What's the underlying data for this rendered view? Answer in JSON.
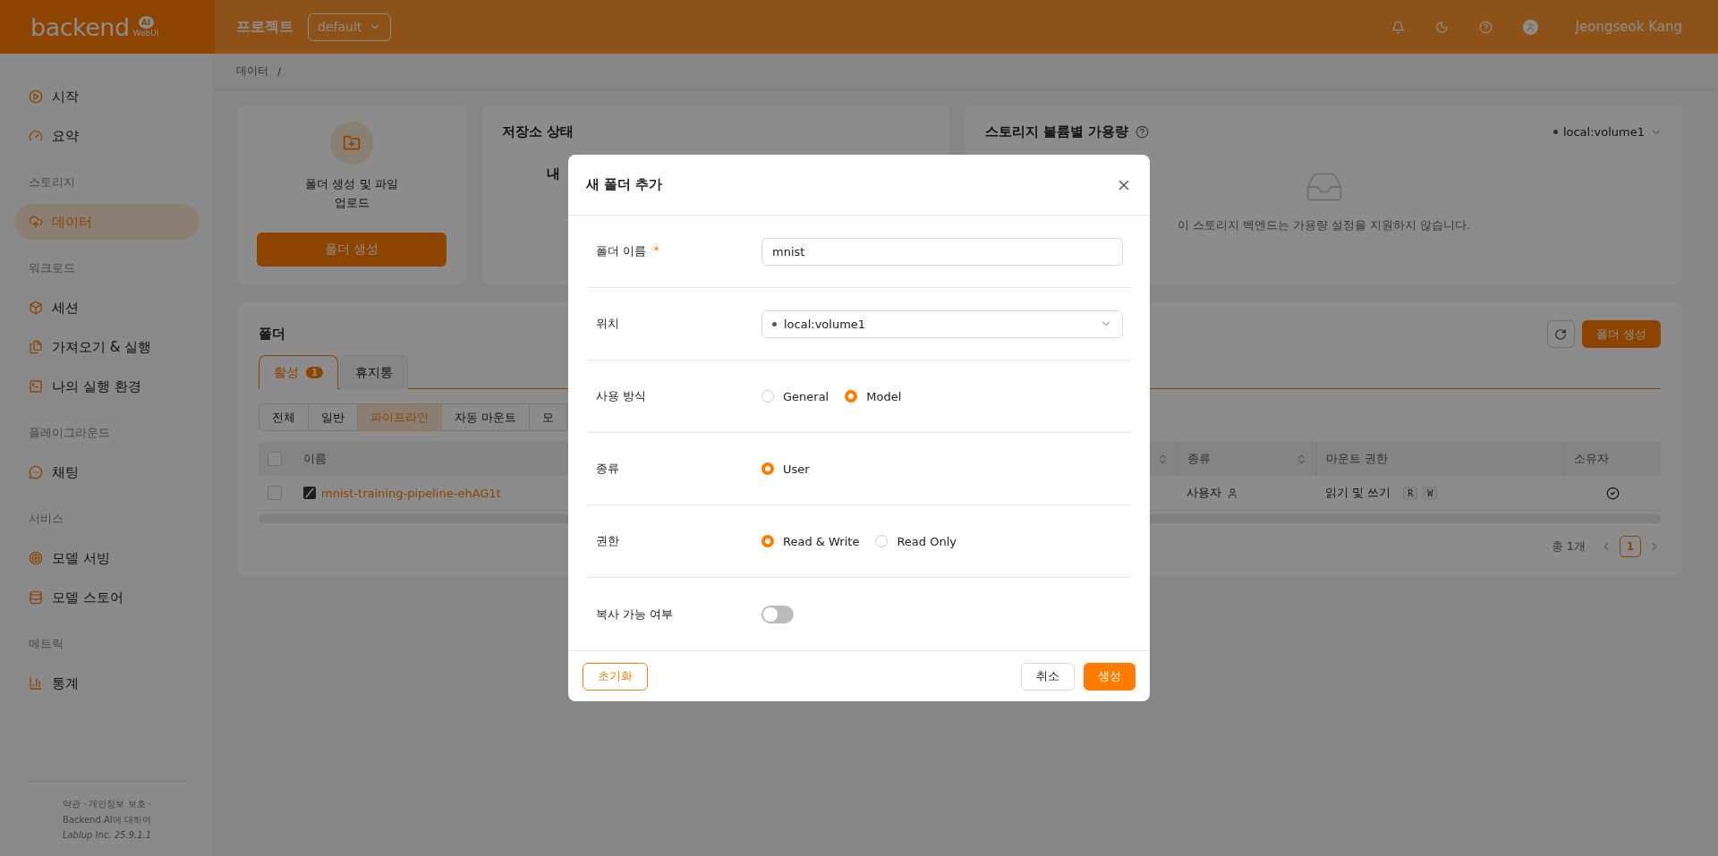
{
  "header": {
    "logo": {
      "word": "backend",
      "badge": "AI",
      "sub": "WebUI"
    },
    "project_label": "프로젝트",
    "project_select": "default",
    "user": "Jeongseok Kang"
  },
  "sidebar": {
    "groups": [
      {
        "items": [
          {
            "label": "시작",
            "selected": false
          },
          {
            "label": "요약",
            "selected": false
          }
        ]
      },
      {
        "heading": "스토리지",
        "items": [
          {
            "label": "데이터",
            "selected": true
          }
        ]
      },
      {
        "heading": "워크로드",
        "items": [
          {
            "label": "세션",
            "selected": false
          },
          {
            "label": "가져오기 & 실행",
            "selected": false
          },
          {
            "label": "나의 실행 환경",
            "selected": false
          }
        ]
      },
      {
        "heading": "플레이그라운드",
        "items": [
          {
            "label": "채팅",
            "selected": false
          }
        ]
      },
      {
        "heading": "서비스",
        "items": [
          {
            "label": "모델 서빙",
            "selected": false
          },
          {
            "label": "모델 스토어",
            "selected": false
          }
        ]
      },
      {
        "heading": "메트릭",
        "items": [
          {
            "label": "통계",
            "selected": false
          }
        ]
      }
    ],
    "footer": [
      "약관 · 개인정보 보호 ·",
      "Backend.AI에 대하여",
      "Lablup Inc. 25.9.1.1"
    ]
  },
  "breadcrumb": [
    "데이터",
    "/"
  ],
  "create_card": {
    "text": "폴더 생성 및 파일 업로드",
    "button": "폴더 생성"
  },
  "status_card": {
    "title": "저장소 상태",
    "partial": "내"
  },
  "quota_card": {
    "title": "스토리지 볼륨별 가용량",
    "select": "local:volume1",
    "empty": "이 스토리지 백엔드는 가용량 설정을 지원하지 않습니다."
  },
  "folders": {
    "title": "폴더",
    "button": "폴더 생성",
    "tabs": [
      {
        "label": "활성",
        "badge": "1",
        "selected": true
      },
      {
        "label": "휴지통",
        "selected": false
      }
    ],
    "filters": [
      {
        "label": "전체",
        "selected": false
      },
      {
        "label": "일반",
        "selected": false
      },
      {
        "label": "파이프라인",
        "selected": true
      },
      {
        "label": "자동 마운트",
        "selected": false
      },
      {
        "label": "모",
        "selected": false
      }
    ],
    "table": {
      "header_checked": false,
      "columns": [
        "이름",
        "종류",
        "마운트 권한",
        "소유자"
      ],
      "rows": [
        {
          "checked": false,
          "name": "mnist-training-pipeline-ehAG1t",
          "type": "사용자",
          "permission": "읽기 및 쓰기",
          "badges": [
            "R",
            "W"
          ],
          "owner": true
        }
      ]
    },
    "total": "총 1개",
    "pages": [
      {
        "label": "1",
        "selected": true
      }
    ]
  },
  "modal": {
    "title": "새 폴더 추가",
    "fields": [
      {
        "kind": "text",
        "label": "폴더 이름",
        "required_mark": "*",
        "value": "mnist"
      },
      {
        "kind": "select",
        "label": "위치",
        "value": "local:volume1"
      },
      {
        "kind": "radio",
        "label": "사용 방식",
        "options": [
          {
            "label": "General",
            "selected": false
          },
          {
            "label": "Model",
            "selected": true
          }
        ]
      },
      {
        "kind": "radio",
        "label": "종류",
        "options": [
          {
            "label": "User",
            "selected": true
          }
        ]
      },
      {
        "kind": "radio",
        "label": "권한",
        "options": [
          {
            "label": "Read & Write",
            "selected": true
          },
          {
            "label": "Read Only",
            "selected": false
          }
        ]
      },
      {
        "kind": "switch",
        "label": "복사 가능 여부",
        "on": false
      }
    ],
    "reset": "초기화",
    "cancel": "취소",
    "submit": "생성"
  }
}
